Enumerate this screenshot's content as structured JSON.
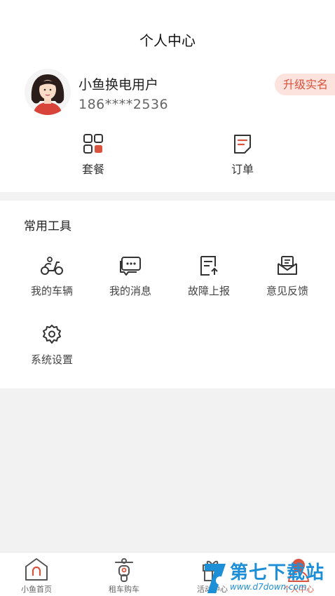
{
  "header": {
    "title": "个人中心"
  },
  "profile": {
    "name": "小鱼换电用户",
    "phone": "186****2536",
    "upgrade_label": "升级实名"
  },
  "quick_links": [
    {
      "label": "套餐",
      "icon": "package-grid-icon"
    },
    {
      "label": "订单",
      "icon": "order-document-icon"
    }
  ],
  "tools": {
    "title": "常用工具",
    "items": [
      {
        "label": "我的车辆",
        "icon": "scooter-icon"
      },
      {
        "label": "我的消息",
        "icon": "message-icon"
      },
      {
        "label": "故障上报",
        "icon": "report-icon"
      },
      {
        "label": "意见反馈",
        "icon": "feedback-icon"
      },
      {
        "label": "系统设置",
        "icon": "gear-icon"
      }
    ]
  },
  "tabbar": {
    "items": [
      {
        "label": "小鱼首页",
        "icon": "home-icon"
      },
      {
        "label": "租车购车",
        "icon": "rent-scooter-icon"
      },
      {
        "label": "活动中心",
        "icon": "gift-icon"
      },
      {
        "label": "个人中心",
        "icon": "profile-icon",
        "active": true
      }
    ]
  },
  "watermark": {
    "title": "第七下载站",
    "subtitle": "www.d7down.com"
  },
  "colors": {
    "accent": "#d9533f",
    "accent_light": "#fde3dd",
    "page_bg": "#f2f2f2",
    "watermark": "#1d8fd6"
  }
}
